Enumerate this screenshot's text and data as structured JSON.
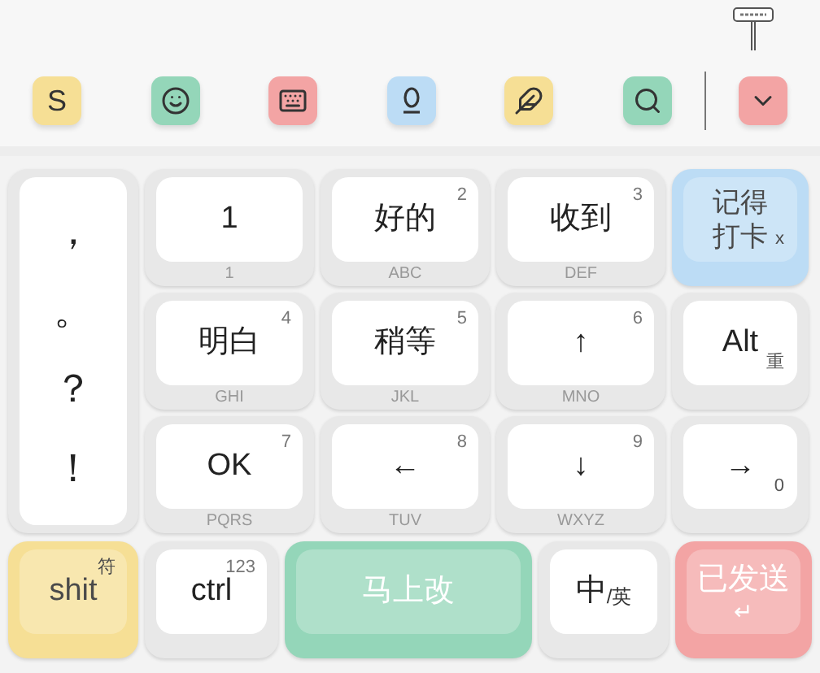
{
  "toolbar": {
    "buttons": [
      {
        "kind": "letter",
        "label": "S",
        "color": "#f6df95"
      },
      {
        "kind": "smile",
        "color": "#94d6b9"
      },
      {
        "kind": "keyboard",
        "color": "#f3a4a4"
      },
      {
        "kind": "underline",
        "color": "#bcdcf5"
      },
      {
        "kind": "pen",
        "color": "#f6df95"
      },
      {
        "kind": "search",
        "color": "#94d6b9"
      }
    ],
    "collapse": {
      "kind": "chevron",
      "color": "#f3a4a4"
    }
  },
  "punctuation": [
    "，",
    "。",
    "？",
    "！"
  ],
  "keys": [
    {
      "label": "1",
      "letters": "1"
    },
    {
      "label": "好的",
      "digit": "2",
      "letters": "ABC"
    },
    {
      "label": "收到",
      "digit": "3",
      "letters": "DEF"
    },
    {
      "label": "记得打卡",
      "corner": "x",
      "color": "#bcdcf5"
    },
    {
      "label": "明白",
      "digit": "4",
      "letters": "GHI"
    },
    {
      "label": "稍等",
      "digit": "5",
      "letters": "JKL"
    },
    {
      "label": "↑",
      "digit": "6",
      "letters": "MNO"
    },
    {
      "label": "Alt",
      "corner": "重"
    },
    {
      "label": "OK",
      "digit": "7",
      "letters": "PQRS"
    },
    {
      "label": "←",
      "digit": "8",
      "letters": "TUV"
    },
    {
      "label": "↓",
      "digit": "9",
      "letters": "WXYZ"
    },
    {
      "label": "→",
      "corner": "0"
    }
  ],
  "bottom_row": [
    {
      "label": "shit",
      "digit": "符",
      "color": "#f6df95"
    },
    {
      "label": "ctrl",
      "digit": "123"
    },
    {
      "label": "马上改",
      "color": "#94d6b9"
    },
    {
      "label": "中",
      "suffix": "/英"
    },
    {
      "label": "已发送",
      "below": "↵",
      "color": "#f3a4a4"
    }
  ]
}
